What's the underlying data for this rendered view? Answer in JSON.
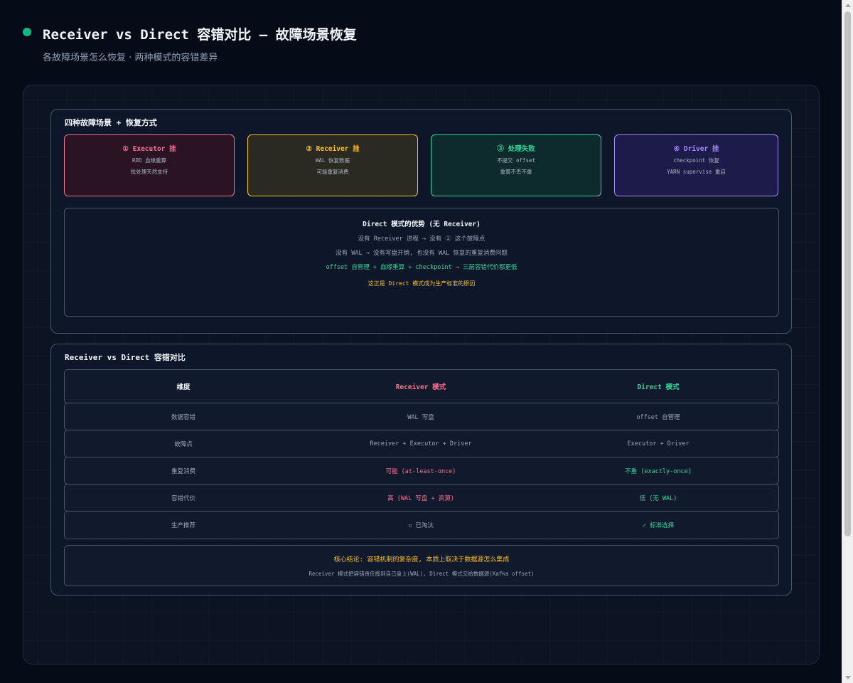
{
  "header": {
    "title": "Receiver vs Direct 容错对比 — 故障场景恢复",
    "subtitle": "各故障场景怎么恢复 · 两种模式的容错差异"
  },
  "scenarios": {
    "title": "四种故障场景 + 恢复方式",
    "cards": [
      {
        "title": "① Executor 挂",
        "lines": [
          "RDD 血缘重算",
          "批处理天然支持"
        ],
        "color": "#f87191"
      },
      {
        "title": "② Receiver 挂",
        "lines": [
          "WAL 恢复数据",
          "可能重复消费"
        ],
        "color": "#fbbf24"
      },
      {
        "title": "③ 处理失败",
        "lines": [
          "不提交 offset",
          "重算不丢不重"
        ],
        "color": "#34d399"
      },
      {
        "title": "④ Driver 挂",
        "lines": [
          "checkpoint 恢复",
          "YARN supervise 重启"
        ],
        "color": "#a78bfa"
      }
    ],
    "advantage": {
      "title": "Direct 模式的优势 (无 Receiver)",
      "line1": "没有 Receiver 进程 → 没有 ② 这个故障点",
      "line2": "没有 WAL → 没有写盘开销, 也没有 WAL 恢复的重复消费问题",
      "line3": "offset 自管理 + 血缘重算 + checkpoint → 三层容错代价都更低",
      "note": "这正是 Direct 模式成为生产标准的原因"
    }
  },
  "comparison": {
    "title": "Receiver vs Direct 容错对比",
    "headers": [
      "维度",
      "Receiver 模式",
      "Direct 模式"
    ],
    "rows": [
      [
        "数据容错",
        "WAL 写盘",
        "offset 自管理"
      ],
      [
        "故障点",
        "Receiver + Executor + Driver",
        "Executor + Driver"
      ],
      [
        "重复消费",
        "可能 (at-least-once)",
        "不重 (exactly-once)"
      ],
      [
        "容错代价",
        "高 (WAL 写盘 + 资源)",
        "低 (无 WAL)"
      ],
      [
        "生产推荐",
        "▫ 已淘汰",
        "✓ 标准选择"
      ]
    ],
    "conclusion": {
      "title": "核心结论: 容错机制的复杂度, 本质上取决于数据源怎么集成",
      "detail": "Receiver 模式把容错责任揽到自己身上(WAL), Direct 模式交给数据源(Kafka offset)"
    }
  },
  "colors": {
    "accent_green": "#10b981",
    "red": "#f87191",
    "yellow": "#fbbf24",
    "green": "#34d399",
    "purple": "#a78bfa"
  }
}
